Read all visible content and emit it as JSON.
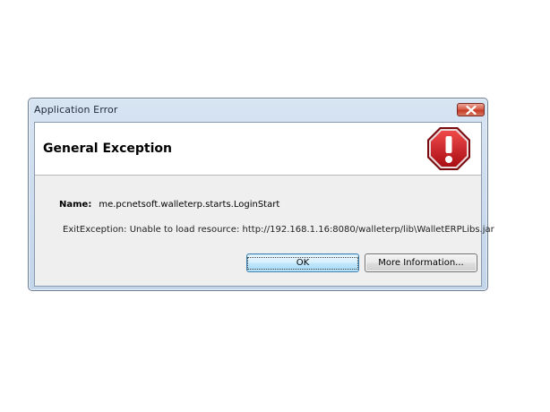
{
  "window": {
    "title": "Application Error",
    "close_icon": "close-icon"
  },
  "header": {
    "title": "General Exception",
    "icon": "stop-error-icon",
    "icon_color": "#c8141e"
  },
  "details": {
    "name_label": "Name:",
    "name_value": "me.pcnetsoft.walleterp.starts.LoginStart",
    "exception_message": "ExitException: Unable to load resource: http://192.168.1.16:8080/walleterp/lib\\WalletERPLibs.jar"
  },
  "buttons": {
    "ok_label": "OK",
    "more_label": "More Information..."
  }
}
